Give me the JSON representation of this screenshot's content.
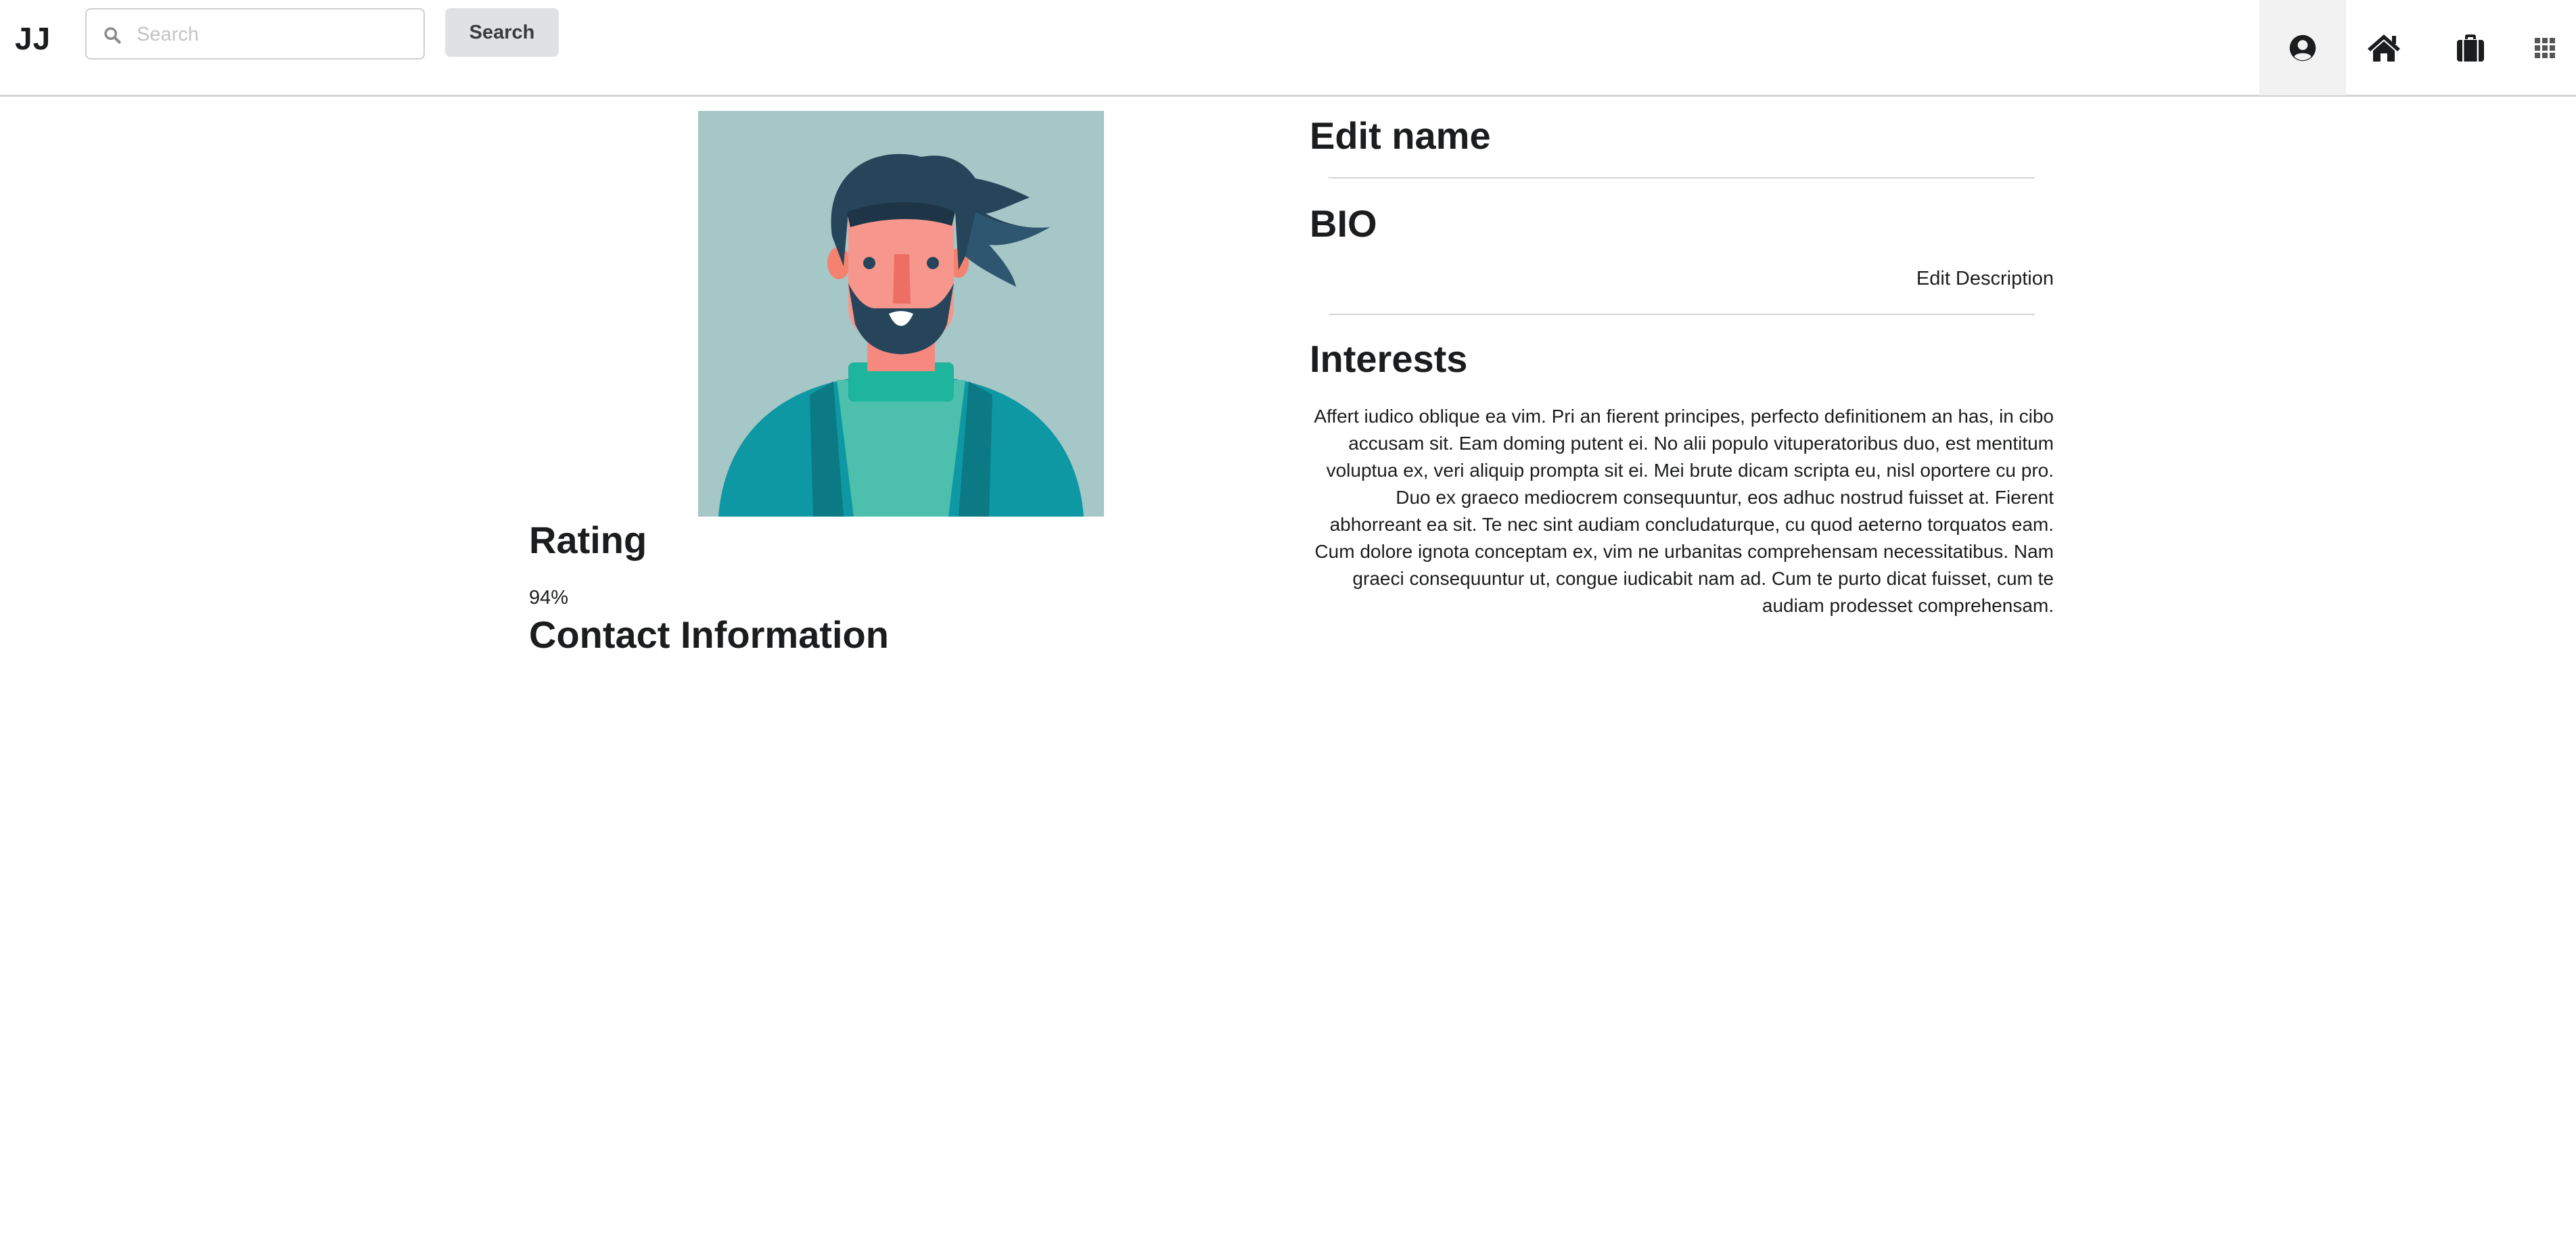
{
  "header": {
    "brand": "JJ",
    "search": {
      "placeholder": "Search",
      "value": ""
    },
    "search_button_label": "Search",
    "nav_icons": [
      "user-circle-icon",
      "home-icon",
      "briefcase-icon",
      "grid-icon"
    ],
    "active_nav": "user-circle-icon"
  },
  "profile": {
    "avatar_icon": "bearded-man-avatar",
    "rating_heading": "Rating",
    "rating_value": "94%",
    "contact_heading": "Contact Information",
    "edit_name_heading": "Edit name",
    "bio_heading": "BIO",
    "edit_description_label": "Edit Description",
    "interests_heading": "Interests",
    "interests_text": "Affert iudico oblique ea vim. Pri an fierent principes, perfecto definitionem an has, in cibo accusam sit. Eam doming putent ei. No alii populo vituperatoribus duo, est mentitum voluptua ex, veri aliquip prompta sit ei. Mei brute dicam scripta eu, nisl oportere cu pro. Duo ex graeco mediocrem consequuntur, eos adhuc nostrud fuisset at. Fierent abhorreant ea sit. Te nec sint audiam concludaturque, cu quod aeterno torquatos eam. Cum dolore ignota conceptam ex, vim ne urbanitas comprehensam necessitatibus. Nam graeci consequuntur ut, congue iudicabit nam ad. Cum te purto dicat fuisset, cum te audiam prodesset comprehensam."
  },
  "colors": {
    "header_border": "#d4d4d5",
    "active_nav_bg": "#f2f2f2",
    "button_bg": "#e0e1e2",
    "avatar_bg": "#a6c7c8"
  }
}
